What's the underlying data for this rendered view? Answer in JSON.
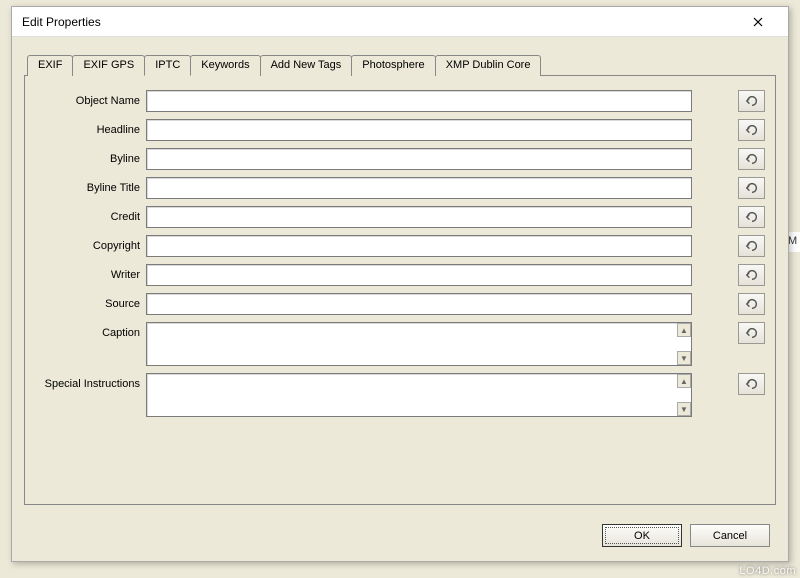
{
  "window": {
    "title": "Edit Properties",
    "close_tooltip": "Close"
  },
  "tabs": [
    {
      "label": "EXIF",
      "active": false
    },
    {
      "label": "EXIF GPS",
      "active": false
    },
    {
      "label": "IPTC",
      "active": true
    },
    {
      "label": "Keywords",
      "active": false
    },
    {
      "label": "Add New Tags",
      "active": false
    },
    {
      "label": "Photosphere",
      "active": false
    },
    {
      "label": "XMP Dublin Core",
      "active": false
    }
  ],
  "fields": {
    "objectName": {
      "label": "Object Name",
      "value": "",
      "type": "text"
    },
    "headline": {
      "label": "Headline",
      "value": "",
      "type": "text"
    },
    "byline": {
      "label": "Byline",
      "value": "",
      "type": "text"
    },
    "bylineTitle": {
      "label": "Byline Title",
      "value": "",
      "type": "text"
    },
    "credit": {
      "label": "Credit",
      "value": "",
      "type": "text"
    },
    "copyright": {
      "label": "Copyright",
      "value": "",
      "type": "text"
    },
    "writer": {
      "label": "Writer",
      "value": "",
      "type": "text"
    },
    "source": {
      "label": "Source",
      "value": "",
      "type": "text"
    },
    "caption": {
      "label": "Caption",
      "value": "",
      "type": "textarea"
    },
    "specialInstructions": {
      "label": "Special Instructions",
      "value": "",
      "type": "textarea"
    }
  },
  "buttons": {
    "ok": "OK",
    "cancel": "Cancel",
    "revert_tooltip": "Revert"
  },
  "bg_fragment_text": "M",
  "watermark": "LO4D.com"
}
